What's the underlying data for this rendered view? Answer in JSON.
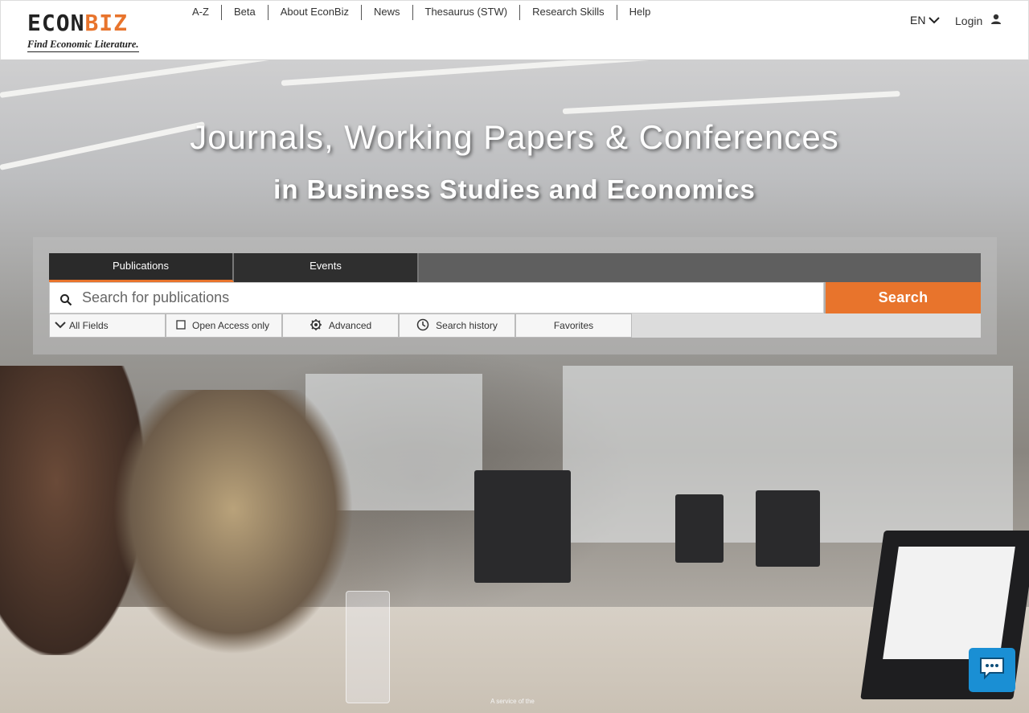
{
  "header": {
    "logo_word_a": "ECON",
    "logo_word_b": "BIZ",
    "logo_tagline": "Find Economic Literature.",
    "nav": [
      "A-Z",
      "Beta",
      "About EconBiz",
      "News",
      "Thesaurus (STW)",
      "Research Skills",
      "Help"
    ],
    "language": "EN",
    "login_label": "Login"
  },
  "hero": {
    "headline": "Journals, Working Papers & Conferences",
    "subline": "in Business Studies and Economics"
  },
  "search": {
    "tabs": [
      "Publications",
      "Events"
    ],
    "active_tab": "Publications",
    "placeholder": "Search for publications",
    "value": "",
    "button_label": "Search",
    "options": {
      "fields": "All Fields",
      "open_access": "Open Access only",
      "advanced": "Advanced",
      "history": "Search history",
      "favorites": "Favorites"
    }
  },
  "footer": {
    "service_text": "A service of the"
  },
  "colors": {
    "accent": "#e8742c",
    "chat": "#1a8fd4"
  },
  "icons": [
    "search-icon",
    "chevron-down-icon",
    "user-icon",
    "checkbox-icon",
    "gear-icon",
    "clock-icon",
    "chat-icon"
  ]
}
